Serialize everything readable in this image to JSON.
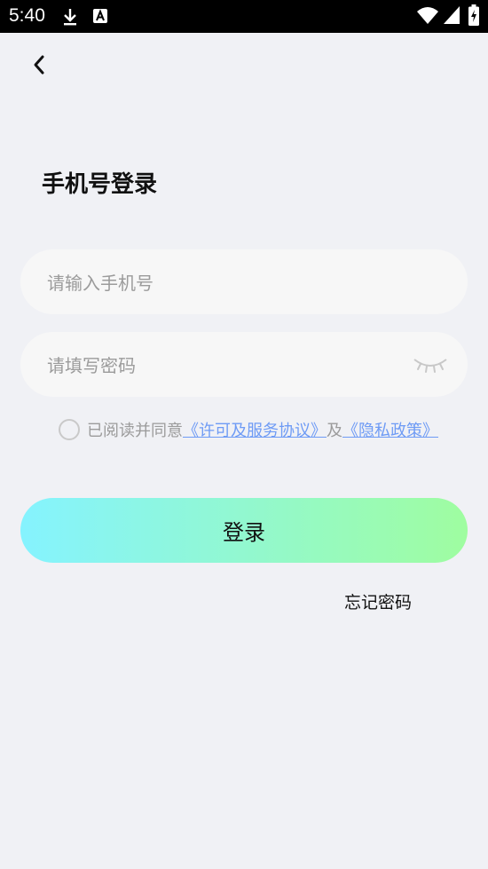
{
  "status_bar": {
    "time": "5:40",
    "icons": [
      "download-icon",
      "app-notification-icon",
      "wifi-icon",
      "signal-icon",
      "battery-icon"
    ]
  },
  "header": {
    "back_icon": "chevron-left-icon"
  },
  "page": {
    "title": "手机号登录"
  },
  "form": {
    "phone_placeholder": "请输入手机号",
    "password_placeholder": "请填写密码",
    "password_toggle_icon": "eye-closed-icon"
  },
  "agreement": {
    "prefix": "已阅读并同意",
    "terms_link": "《许可及服务协议》",
    "and": "及",
    "privacy_link": "《隐私政策》"
  },
  "actions": {
    "login_label": "登录",
    "forgot_password_label": "忘记密码"
  },
  "colors": {
    "background": "#f0f1f5",
    "field_background": "#f7f7f7",
    "link": "#6e9bf5",
    "button_gradient_start": "#85f3ff",
    "button_gradient_end": "#9ffda0"
  }
}
